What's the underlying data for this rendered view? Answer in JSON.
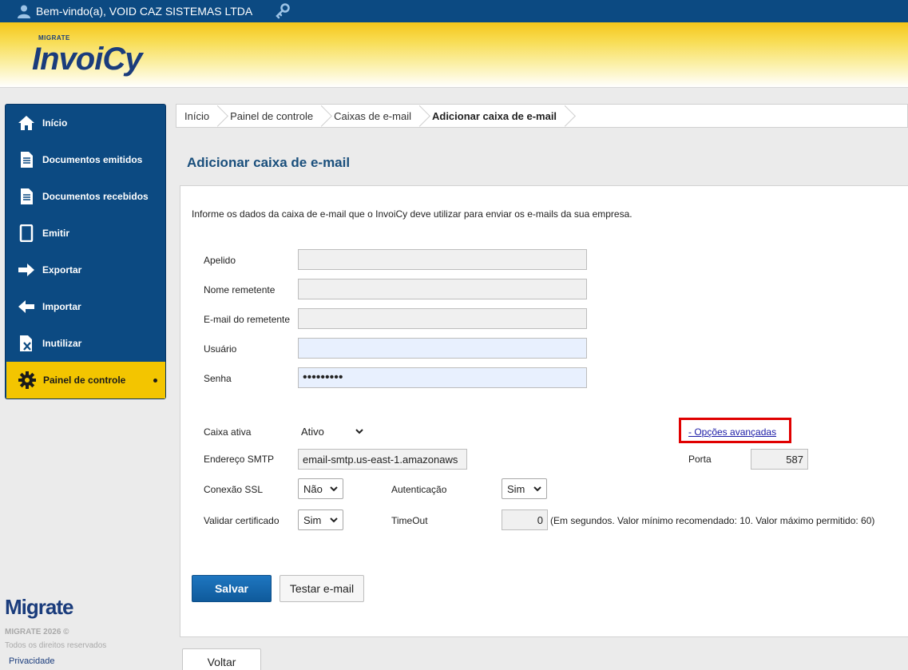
{
  "topbar": {
    "welcome": "Bem-vindo(a), VOID CAZ SISTEMAS LTDA",
    "user_icon": "user-icon",
    "key_icon": "key-icon"
  },
  "header": {
    "brand_small": "MIGRATE",
    "brand": "InvoiCy"
  },
  "sidebar": {
    "items": [
      {
        "label": "Início",
        "icon": "home-icon"
      },
      {
        "label": "Documentos emitidos",
        "icon": "document-icon"
      },
      {
        "label": "Documentos recebidos",
        "icon": "document-icon"
      },
      {
        "label": "Emitir",
        "icon": "tablet-icon"
      },
      {
        "label": "Exportar",
        "icon": "arrow-right-icon"
      },
      {
        "label": "Importar",
        "icon": "arrow-left-icon"
      },
      {
        "label": "Inutilizar",
        "icon": "void-document-icon"
      },
      {
        "label": "Painel de controle",
        "icon": "gear-icon",
        "active": true
      }
    ],
    "footer": {
      "logo": "Migrate",
      "copyright": "MIGRATE 2026 ©",
      "rights": "Todos os direitos reservados",
      "privacy": "Privacidade"
    }
  },
  "breadcrumb": [
    "Início",
    "Painel de controle",
    "Caixas de e-mail",
    "Adicionar caixa de e-mail"
  ],
  "page_title": "Adicionar caixa de e-mail",
  "form": {
    "intro": "Informe os dados da caixa de e-mail que o InvoiCy deve utilizar para enviar os e-mails da sua empresa.",
    "apelido": {
      "label": "Apelido",
      "value": ""
    },
    "nome_remetente": {
      "label": "Nome remetente",
      "value": ""
    },
    "email_remetente": {
      "label": "E-mail do remetente",
      "value": ""
    },
    "usuario": {
      "label": "Usuário",
      "value": ""
    },
    "senha": {
      "label": "Senha",
      "value": "•••••••••"
    },
    "caixa_ativa": {
      "label": "Caixa ativa",
      "value": "Ativo"
    },
    "opcoes_avancadas": "- Opções avançadas",
    "endereco_smtp": {
      "label": "Endereço SMTP",
      "value": "email-smtp.us-east-1.amazonaws"
    },
    "porta": {
      "label": "Porta",
      "value": "587"
    },
    "conexao_ssl": {
      "label": "Conexão SSL",
      "value": "Não"
    },
    "autenticacao": {
      "label": "Autenticação",
      "value": "Sim"
    },
    "validar_certificado": {
      "label": "Validar certificado",
      "value": "Sim"
    },
    "timeout": {
      "label": "TimeOut",
      "value": "0",
      "hint": "(Em segundos. Valor mínimo recomendado: 10. Valor máximo permitido: 60)"
    }
  },
  "buttons": {
    "save": "Salvar",
    "test": "Testar e-mail",
    "back": "Voltar"
  },
  "colors": {
    "primary": "#0c4a82",
    "accent": "#f3c500",
    "highlight_box": "#e00000"
  }
}
